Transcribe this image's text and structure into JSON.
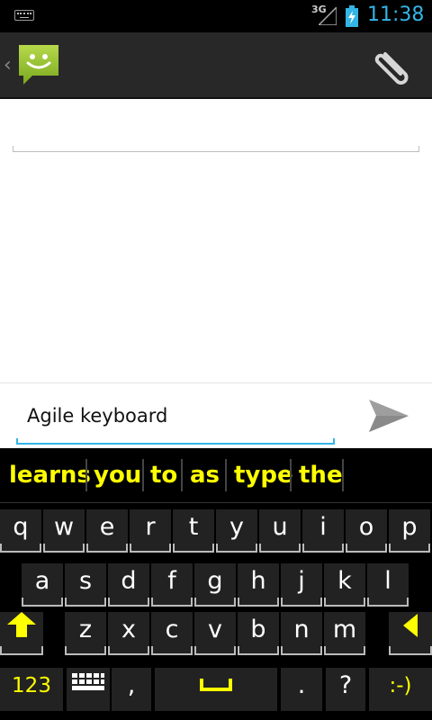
{
  "status_bar": {
    "network_type": "3G",
    "time": "11:38",
    "icons": [
      "keyboard-icon",
      "signal-icon",
      "battery-charging-icon"
    ]
  },
  "action_bar": {
    "app_icon": "messaging-smiley-icon",
    "attach_icon": "paperclip-icon"
  },
  "compose": {
    "message_text": "Agile keyboard",
    "send_icon": "send-arrow-icon"
  },
  "keyboard": {
    "suggestions": [
      "learns",
      "you",
      "to",
      "as",
      "type",
      "the"
    ],
    "row1": [
      "q",
      "w",
      "e",
      "r",
      "t",
      "y",
      "u",
      "i",
      "o",
      "p"
    ],
    "row2": [
      "a",
      "s",
      "d",
      "f",
      "g",
      "h",
      "j",
      "k",
      "l"
    ],
    "row3": [
      "z",
      "x",
      "c",
      "v",
      "b",
      "n",
      "m"
    ],
    "row4": {
      "numbers_label": "123",
      "comma": ",",
      "period": ".",
      "question": "?",
      "emoticon": ":-)"
    },
    "accent_color": "#ffff00"
  },
  "colors": {
    "holo_blue": "#33b5e5",
    "action_bar_bg": "#282828",
    "keyboard_bg": "#000000"
  }
}
